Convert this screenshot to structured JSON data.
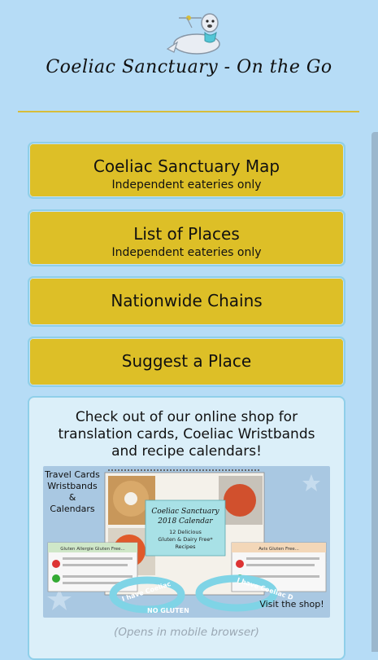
{
  "app": {
    "title": "Coeliac Sanctuary - On the Go"
  },
  "menu": {
    "map": {
      "label": "Coeliac Sanctuary Map",
      "sub": "Independent eateries only"
    },
    "list": {
      "label": "List of Places",
      "sub": "Independent eateries only"
    },
    "chains": {
      "label": "Nationwide Chains"
    },
    "suggest": {
      "label": "Suggest a Place"
    }
  },
  "shop": {
    "text": "Check out of our online shop for translation cards, Coeliac Wristbands and recipe calendars!",
    "image": {
      "side_lines": [
        "Travel Cards",
        "Wristbands",
        "&",
        "Calendars"
      ],
      "calendar_title": "Coeliac Sanctuary",
      "calendar_year": "2018 Calendar",
      "calendar_sub1": "12 Delicious",
      "calendar_sub2": "Gluten & Dairy Free*",
      "calendar_sub3": "Recipes",
      "card_left_title": "Gluten Allergie Gluten Free...",
      "card_right_title": "Avis Gluten Free...",
      "band_left": "I have Coeliac",
      "band_right": "I have Coeliac D",
      "band_bottom": "NO GLUTEN",
      "cta": "Visit the shop!"
    },
    "note": "(Opens in mobile browser)"
  },
  "colors": {
    "background": "#b6dcf6",
    "button": "#ddbf27",
    "border": "#8fcfe9",
    "panel": "#dbeff9"
  }
}
